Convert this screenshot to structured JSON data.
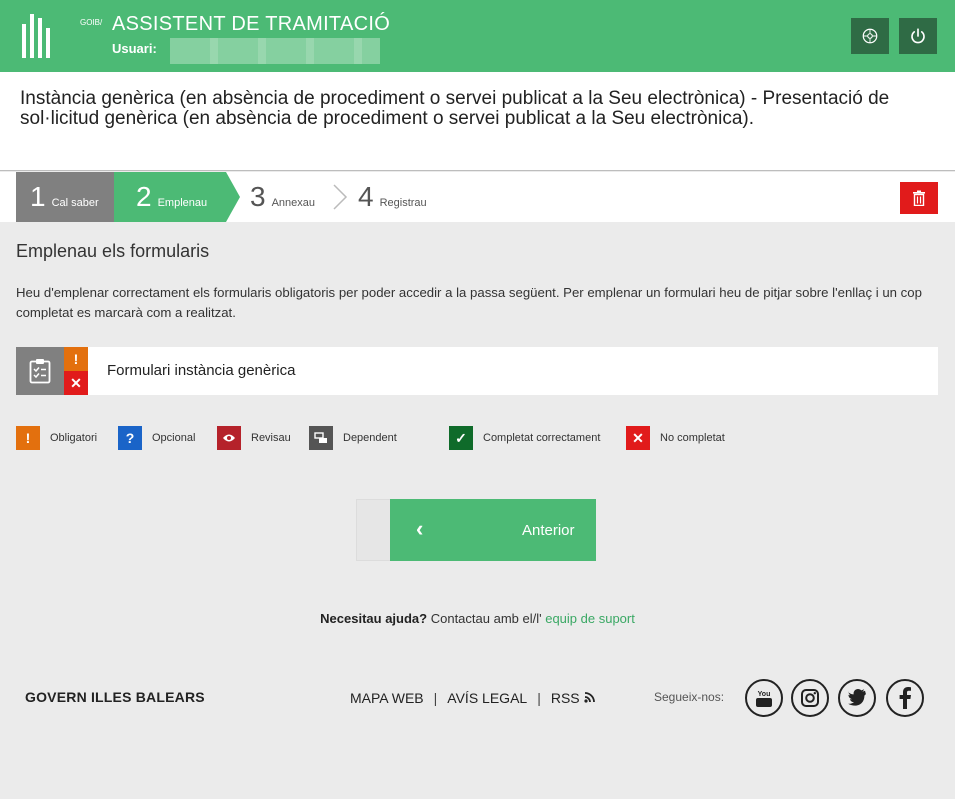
{
  "header": {
    "logo_text": "GOIB/",
    "title": "ASSISTENT DE TRAMITACIÓ",
    "user_label": "Usuari:",
    "color": "#4cba75"
  },
  "page": {
    "title": "Instància genèrica (en absència de procediment o servei publicat a la Seu electrònica) - Presentació de sol·licitud genèrica (en absència de procediment o servei publicat a la Seu electrònica)."
  },
  "steps": [
    {
      "number": "1",
      "label": "Cal saber"
    },
    {
      "number": "2",
      "label": "Emplenau"
    },
    {
      "number": "3",
      "label": "Annexau"
    },
    {
      "number": "4",
      "label": "Registrau"
    }
  ],
  "content": {
    "section_title": "Emplenau els formularis",
    "description": "Heu d'emplenar correctament els formularis obligatoris per poder accedir a la passa següent. Per emplenar un formulari heu de pitjar sobre l'enllaç i un cop completat es marcarà com a realitzat.",
    "form": {
      "label": "Formulari instància genèrica",
      "flag_warn": "!",
      "flag_x": "✕"
    },
    "legend": [
      {
        "label": "Obligatori",
        "color": "#e3700e",
        "icon": "exclamation-icon",
        "glyph": "!"
      },
      {
        "label": "Opcional",
        "color": "#1a64c8",
        "icon": "question-icon",
        "glyph": "?"
      },
      {
        "label": "Revisau",
        "color": "#b5222a",
        "icon": "eye-icon",
        "glyph": ""
      },
      {
        "label": "Dependent",
        "color": "#555555",
        "icon": "dependent-icon",
        "glyph": ""
      },
      {
        "label": "Completat correctament",
        "color": "#0f6b2a",
        "icon": "check-icon",
        "glyph": "✓"
      },
      {
        "label": "No completat",
        "color": "#e11b1b",
        "icon": "x-icon",
        "glyph": "✕"
      }
    ]
  },
  "buttons": {
    "back_label": "Anterior"
  },
  "help": {
    "question": "Necesitau ajuda?",
    "text": "Contactau amb el/l'",
    "link": "equip de suport"
  },
  "footer": {
    "brand": "GOVERN ILLES BALEARS",
    "links": [
      "MAPA WEB",
      "AVÍS LEGAL",
      "RSS"
    ],
    "follow_label": "Segueix-nos:",
    "social": [
      "youtube-icon",
      "instagram-icon",
      "twitter-icon",
      "facebook-icon"
    ]
  }
}
